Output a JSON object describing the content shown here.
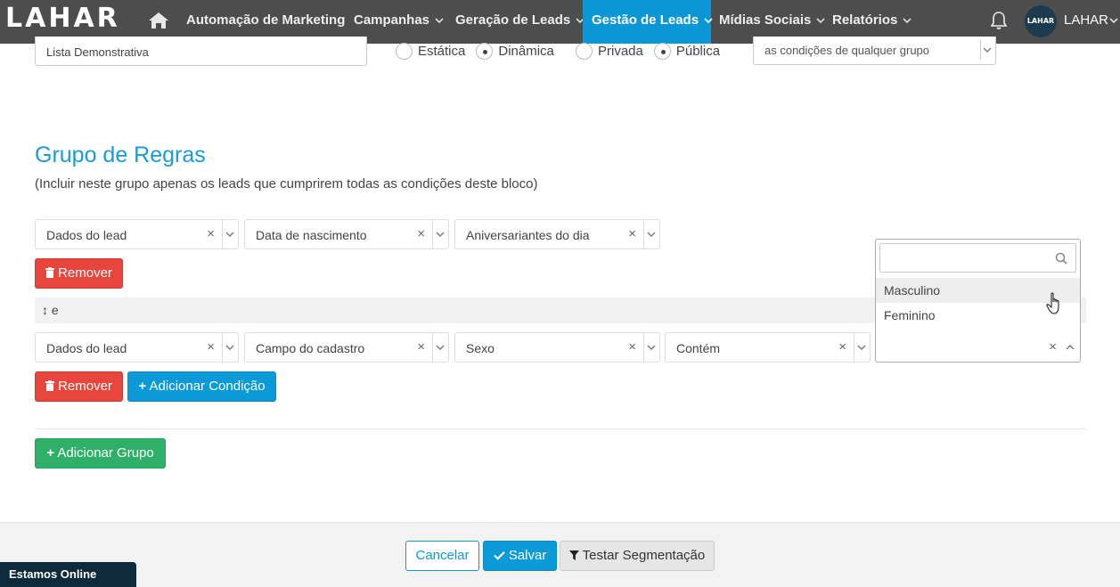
{
  "navbar": {
    "logo": "LAHAR",
    "items": [
      {
        "label": "Automação de Marketing"
      },
      {
        "label": "Campanhas"
      },
      {
        "label": "Geração de Leads"
      },
      {
        "label": "Gestão de Leads"
      },
      {
        "label": "Mídias Sociais"
      },
      {
        "label": "Relatórios"
      }
    ],
    "user": {
      "avatar_text": "LAHAR",
      "label": "LAHAR"
    },
    "active_color": "#0b96d6"
  },
  "form": {
    "list_name": "Lista Demonstrativa",
    "type_options": [
      "Estática",
      "Dinâmica"
    ],
    "type_selected": "Dinâmica",
    "privacy_options": [
      "Privada",
      "Pública"
    ],
    "privacy_selected": "Pública",
    "group_condition": "as condições de qualquer grupo"
  },
  "rules_group": {
    "title": "Grupo de Regras",
    "subtitle": "(Incluir neste grupo apenas os leads que cumprirem todas as condições deste bloco)",
    "rule1": {
      "field1": "Dados do lead",
      "field2": "Data de nascimento",
      "field3": "Aniversariantes do dia"
    },
    "connector": "e",
    "rule2": {
      "field1": "Dados do lead",
      "field2": "Campo do cadastro",
      "field3": "Sexo",
      "field4": "Contém"
    },
    "dropdown": {
      "options": [
        "Masculino",
        "Feminino"
      ],
      "hovered": "Masculino"
    },
    "remove_label": "Remover",
    "add_condition_label": "Adicionar Condição",
    "add_group_label": "Adicionar Grupo"
  },
  "footer": {
    "cancel_label": "Cancelar",
    "save_label": "Salvar",
    "test_label": "Testar Segmentação",
    "chat_label": "Estamos Online"
  },
  "colors": {
    "primary": "#0b9ad8",
    "danger": "#e8453c",
    "success": "#2eb069",
    "title": "#1a9bd7"
  }
}
